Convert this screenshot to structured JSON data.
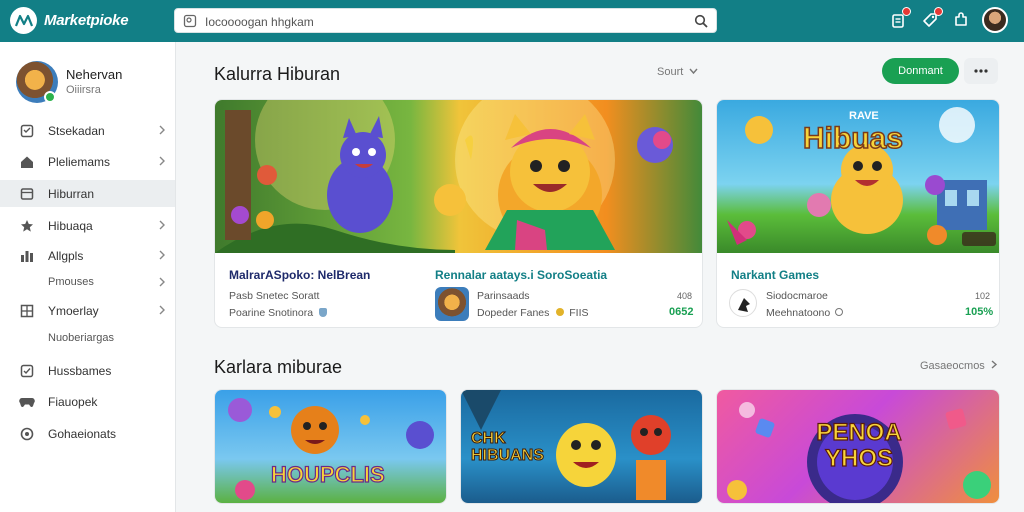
{
  "app": {
    "name": "Marketpioke",
    "brand_color": "#127f86",
    "accent_color": "#1aa053"
  },
  "search": {
    "value": "Iocoooogan hhgkam",
    "icon": "search-icon"
  },
  "header_icons": [
    "notifications-icon",
    "tag-icon",
    "puzzle-icon"
  ],
  "profile": {
    "name": "Nehervan",
    "subtitle": "Oiiirsra"
  },
  "sidebar": {
    "items": [
      {
        "label": "Stsekadan",
        "icon": "shop-icon",
        "chevron": true
      },
      {
        "label": "Pleliemams",
        "icon": "home-icon",
        "chevron": true
      },
      {
        "label": "Hiburran",
        "icon": "library-icon",
        "chevron": false,
        "active": true
      },
      {
        "label": "Hibuaqa",
        "icon": "star-icon",
        "chevron": true
      },
      {
        "label": "Allgpls",
        "icon": "apps-icon",
        "chevron": true
      },
      {
        "label": "Pmouses",
        "icon": "",
        "chevron": true
      },
      {
        "label": "Ymoerlay",
        "icon": "grid-icon",
        "chevron": true
      },
      {
        "label": "Nuoberiargas",
        "icon": "",
        "chevron": false
      },
      {
        "label": "Hussbames",
        "icon": "check-icon",
        "chevron": false
      },
      {
        "label": "Fiauopek",
        "icon": "gamepad-icon",
        "chevron": false
      },
      {
        "label": "Gohaeionats",
        "icon": "settings-icon",
        "chevron": false
      }
    ]
  },
  "section1": {
    "title": "Kalurra Hiburan",
    "sort_label": "Sourt",
    "action_label": "Donmant",
    "cards": [
      {
        "title": "MalrarASpoko: NelBrean",
        "line1": "Pasb Snetec Soratt",
        "line2": "Poarine Snotinora"
      },
      {
        "title": "Rennalar aatays.i SoroSoeatia",
        "line1": "Parinsaads",
        "line2": "Dopeder Fanes",
        "line2b": "FIIS",
        "count": "408",
        "price": "0652"
      },
      {
        "title": "Narkant Games",
        "banner_text": "Hibuas",
        "banner_text_small": "RAVE",
        "line1": "Siodocmaroe",
        "line2": "Meehnatoono",
        "count": "102",
        "price": "105%"
      }
    ]
  },
  "section2": {
    "title": "Karlara miburae",
    "link_label": "Gasaeocmos",
    "cards": [
      {
        "banner_text": "HOUPCLIS"
      },
      {
        "banner_text": "CHK HIBUANS"
      },
      {
        "banner_text": "PENOA YHOS"
      }
    ]
  }
}
